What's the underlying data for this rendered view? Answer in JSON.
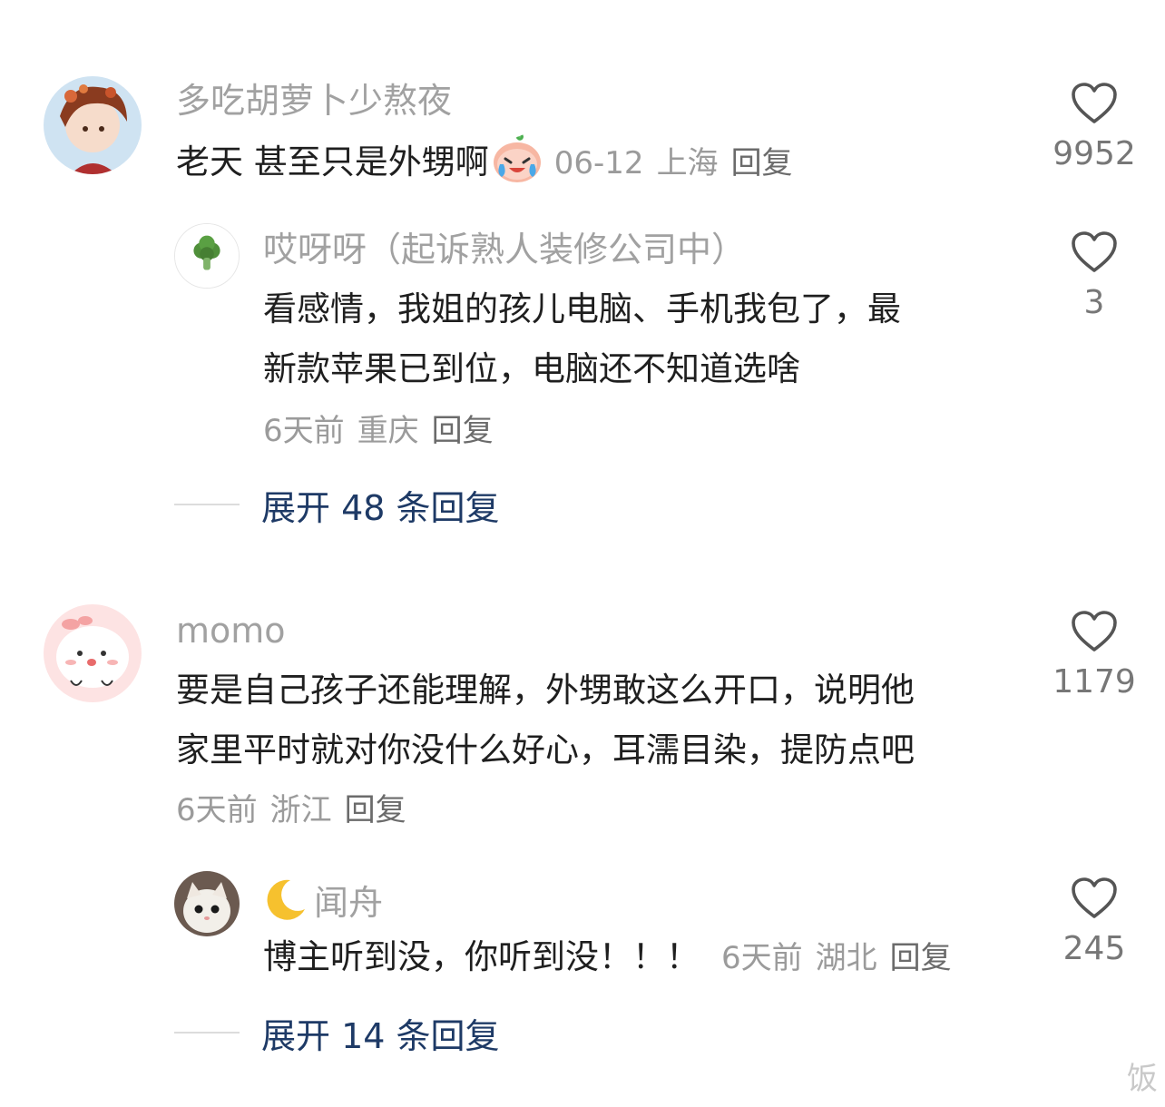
{
  "comments": [
    {
      "username": "多吃胡萝卜少熬夜",
      "text": "老天 甚至只是外甥啊",
      "emoji": "crying-face-emoji",
      "date": "06-12",
      "location": "上海",
      "reply_label": "回复",
      "likes": "9952",
      "replies": [
        {
          "username": "哎呀呀（起诉熟人装修公司中）",
          "text_lines": [
            "看感情，我姐的孩儿电脑、手机我包了，最",
            "新款苹果已到位，电脑还不知道选啥"
          ],
          "date": "6天前",
          "location": "重庆",
          "reply_label": "回复",
          "likes": "3"
        }
      ],
      "expand_label": "展开 48 条回复"
    },
    {
      "username": "momo",
      "text_lines": [
        "要是自己孩子还能理解，外甥敢这么开口，说明他",
        "家里平时就对你没什么好心，耳濡目染，提防点吧"
      ],
      "date": "6天前",
      "location": "浙江",
      "reply_label": "回复",
      "likes": "1179",
      "replies": [
        {
          "username": "闻舟",
          "name_icon": "crescent-moon-emoji",
          "text": "博主听到没，你听到没！！！",
          "date": "6天前",
          "location": "湖北",
          "reply_label": "回复",
          "likes": "245"
        }
      ],
      "expand_label": "展开 14 条回复"
    }
  ],
  "watermark": "饭",
  "colors": {
    "username": "#a1a1a1",
    "text": "#1f1f1f",
    "meta": "#9b9b9b",
    "expand": "#1e3a66",
    "heart": "#555555"
  }
}
